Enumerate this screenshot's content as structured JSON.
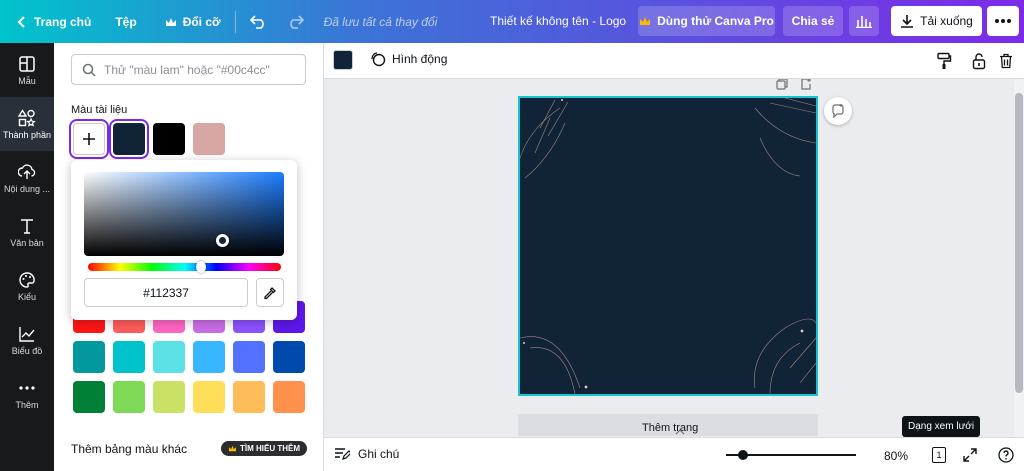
{
  "topbar": {
    "home_label": "Trang chủ",
    "file_label": "Tệp",
    "resize_label": "Đổi cỡ",
    "status": "Đã lưu tất cả thay đổi",
    "title": "Thiết kế không tên - Logo",
    "try_pro_label": "Dùng thử Canva Pro",
    "share_label": "Chia sẻ",
    "download_label": "Tải xuống"
  },
  "sidebar": {
    "items": [
      {
        "label": "Mẫu",
        "icon": "template-icon"
      },
      {
        "label": "Thành phần",
        "icon": "elements-icon"
      },
      {
        "label": "Nội dung ...",
        "icon": "upload-icon"
      },
      {
        "label": "Văn bản",
        "icon": "text-icon"
      },
      {
        "label": "Kiểu",
        "icon": "palette-icon"
      },
      {
        "label": "Biểu đồ",
        "icon": "chart-icon"
      },
      {
        "label": "Thêm",
        "icon": "more-icon"
      }
    ]
  },
  "panel": {
    "search_placeholder": "Thử \"màu lam\" hoặc \"#00c4cc\"",
    "doc_colors_label": "Màu tài liệu",
    "doc_colors": [
      "#112337",
      "#000000",
      "#d8a7a4"
    ],
    "picker_hex": "#112337",
    "palette_rows": [
      [
        "#ff1616",
        "#ff5c5c",
        "#ff66c4",
        "#cb6ce6",
        "#8c52ff",
        "#5e17eb"
      ],
      [
        "#03989e",
        "#00c2cb",
        "#5ce1e6",
        "#38b6ff",
        "#5271ff",
        "#004aad"
      ],
      [
        "#008037",
        "#7ed957",
        "#c9e265",
        "#ffde59",
        "#ffbd59",
        "#ff914d"
      ]
    ],
    "more_colors_label": "Thêm bảng màu khác",
    "learn_more_label": "TÌM HIỂU THÊM"
  },
  "toolbar2": {
    "current_color": "#112337",
    "animate_label": "Hình động"
  },
  "canvas": {
    "page_color": "#112337",
    "add_page_label": "Thêm trang"
  },
  "bottombar": {
    "notes_label": "Ghi chú",
    "zoom": "80%",
    "zoom_fraction": 0.1,
    "page_count": "1",
    "tooltip": "Dạng xem lưới"
  }
}
